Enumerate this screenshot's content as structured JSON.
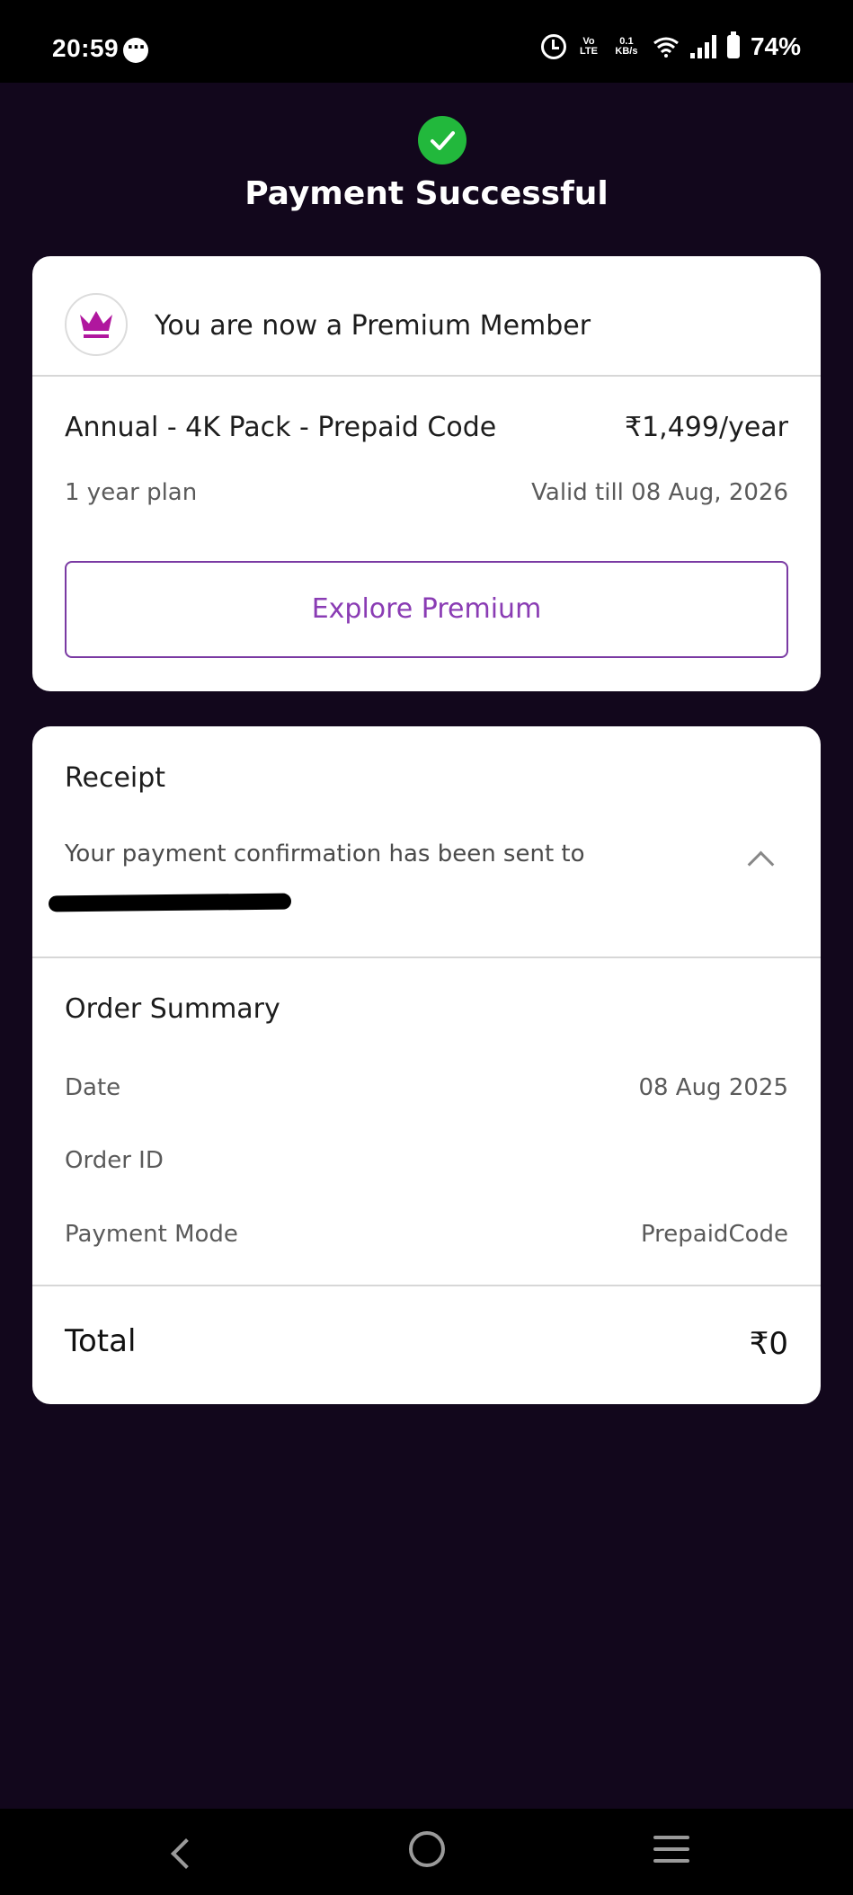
{
  "status_bar": {
    "time": "20:59",
    "net_lte": "Vo LTE",
    "net_speed": "0.1 KB/s",
    "battery": "74%"
  },
  "header": {
    "title": "Payment Successful"
  },
  "membership": {
    "message": "You are now a Premium Member",
    "plan_name": "Annual - 4K Pack - Prepaid Code",
    "plan_price": "₹1,499/year",
    "plan_duration": "1 year plan",
    "valid_till": "Valid till 08 Aug, 2026",
    "explore_label": "Explore Premium"
  },
  "receipt": {
    "title": "Receipt",
    "message": "Your payment confirmation has been sent to"
  },
  "order_summary": {
    "title": "Order Summary",
    "rows": [
      {
        "label": "Date",
        "value": "08 Aug 2025"
      },
      {
        "label": "Order ID",
        "value": ""
      },
      {
        "label": "Payment Mode",
        "value": "PrepaidCode"
      }
    ],
    "total_label": "Total",
    "total_value": "₹0"
  },
  "colors": {
    "background": "#12071c",
    "accent": "#8a3cb4",
    "success": "#22b83c",
    "crown": "#b0179e"
  },
  "icons": {
    "success": "check-circle-icon",
    "crown": "crown-icon",
    "collapse": "chevron-up-icon"
  }
}
